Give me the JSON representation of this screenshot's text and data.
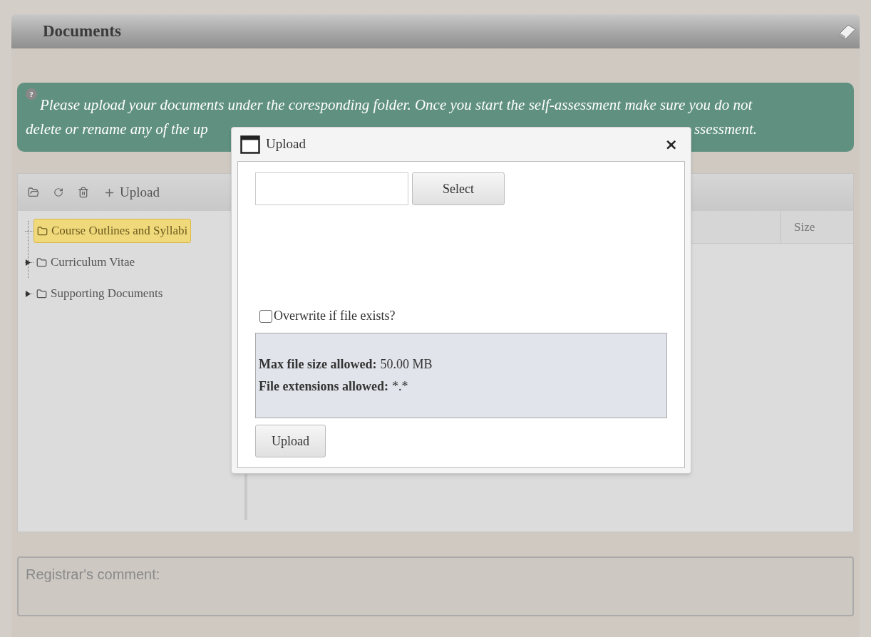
{
  "header": {
    "title": "Documents"
  },
  "notice": {
    "icon": "?",
    "line_1": "Please upload your documents under the coresponding folder. Once you start the self-assessment make sure you do not",
    "line_2_start": "delete or rename any of the up",
    "line_2_end": "ssessment."
  },
  "toolbar": {
    "upload_label": "Upload"
  },
  "tree": [
    {
      "label": "Course Outlines and Syllabi",
      "selected": true,
      "collapsible": false
    },
    {
      "label": "Curriculum Vitae",
      "selected": false,
      "collapsible": true
    },
    {
      "label": "Supporting Documents",
      "selected": false,
      "collapsible": true
    }
  ],
  "table": {
    "columns": [
      {
        "label": "Size"
      }
    ]
  },
  "dialog": {
    "title": "Upload",
    "close": "×",
    "select_button": "Select",
    "overwrite": {
      "label": "Overwrite if file exists?",
      "checked": false
    },
    "info": [
      {
        "label": "Max file size allowed:",
        "value": "50.00 MB"
      },
      {
        "label": "File extensions allowed:",
        "value": "*.*"
      }
    ],
    "upload_button": "Upload"
  },
  "comment": {
    "placeholder": "Registrar's comment:"
  }
}
